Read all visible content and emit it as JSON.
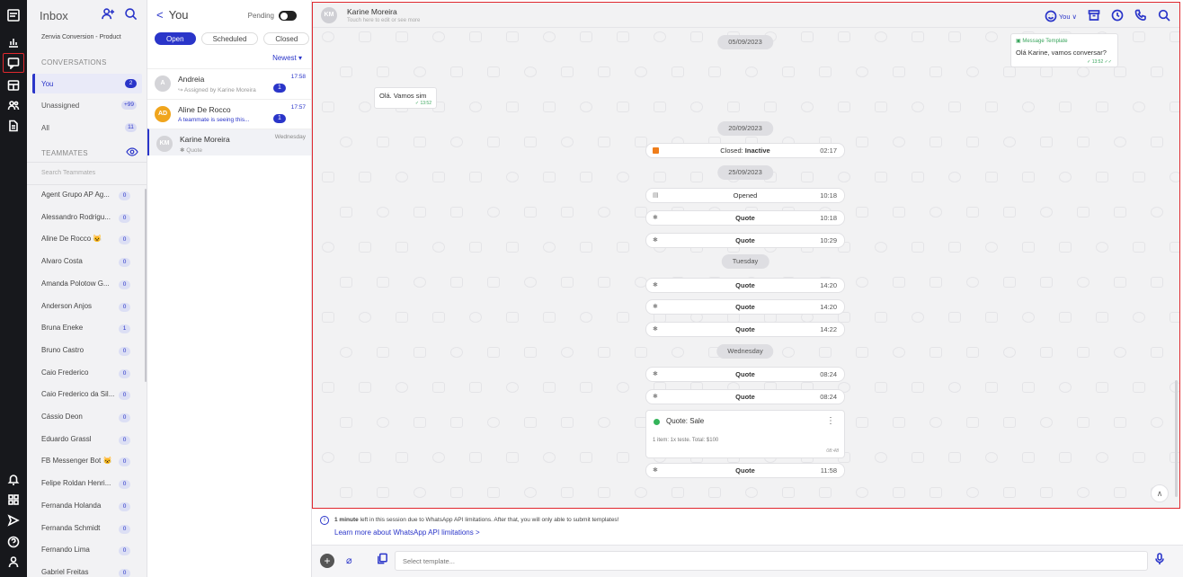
{
  "rail": {
    "top_icons": [
      "logo-icon",
      "reports-icon",
      "conversations-icon",
      "dashboard-icon",
      "contacts-icon",
      "documents-icon"
    ],
    "bottom_icons": [
      "bell-icon",
      "apps-icon",
      "send-icon",
      "help-icon",
      "profile-icon"
    ]
  },
  "inbox": {
    "title": "Inbox",
    "workspace": "Zenvia Conversion - Product",
    "conversations_label": "CONVERSATIONS",
    "items": [
      {
        "label": "You",
        "count": "2"
      },
      {
        "label": "Unassigned",
        "count": "+99"
      },
      {
        "label": "All",
        "count": "11"
      }
    ],
    "teammates_label": "TEAMMATES",
    "search_placeholder": "Search Teammates",
    "teammates": [
      {
        "name": "Agent Grupo AP Ag...",
        "count": "0"
      },
      {
        "name": "Alessandro Rodrigu...",
        "count": "0"
      },
      {
        "name": "Aline De Rocco 😺",
        "count": "0"
      },
      {
        "name": "Alvaro Costa",
        "count": "0"
      },
      {
        "name": "Amanda Polotow G...",
        "count": "0"
      },
      {
        "name": "Anderson Anjos",
        "count": "0"
      },
      {
        "name": "Bruna Eneke",
        "count": "1"
      },
      {
        "name": "Bruno Castro",
        "count": "0"
      },
      {
        "name": "Caio Frederico",
        "count": "0"
      },
      {
        "name": "Caio Frederico da Sil...",
        "count": "0"
      },
      {
        "name": "Cássio Deon",
        "count": "0"
      },
      {
        "name": "Eduardo Grassl",
        "count": "0"
      },
      {
        "name": "FB Messenger Bot 😺",
        "count": "0"
      },
      {
        "name": "Felipe Roldan Henri...",
        "count": "0"
      },
      {
        "name": "Fernanda Holanda",
        "count": "0"
      },
      {
        "name": "Fernanda Schmidt",
        "count": "0"
      },
      {
        "name": "Fernando Lima",
        "count": "0"
      },
      {
        "name": "Gabriel Freitas",
        "count": "0"
      }
    ]
  },
  "conv_list": {
    "title": "You",
    "pending_label": "Pending",
    "tabs": [
      "Open",
      "Scheduled",
      "Closed"
    ],
    "sort_label": "Newest ▾",
    "conversations": [
      {
        "initials": "A",
        "name": "Andreia",
        "subtitle": "↪ Assigned by Karine Moreira",
        "time": "17:58",
        "unread": "1"
      },
      {
        "initials": "AD",
        "name": "Aline De Rocco",
        "subtitle": "A teammate is seeing this...",
        "time": "17:57",
        "unread": "1"
      },
      {
        "initials": "KM",
        "name": "Karine Moreira",
        "subtitle": "Quote",
        "time": "Wednesday",
        "unread": ""
      }
    ]
  },
  "chat": {
    "contact_initials": "KM",
    "contact_name": "Karine Moreira",
    "contact_sub": "Touch here to edit or see more",
    "assignee_label": "You",
    "dates": [
      "05/09/2023",
      "20/09/2023",
      "25/09/2023",
      "Tuesday",
      "Wednesday"
    ],
    "incoming_text": "Olá. Vamos sim",
    "incoming_meta": "✓ 13:52",
    "template_header": "Message Template",
    "template_text": "Olá Karine, vamos conversar?",
    "template_meta": "✓ 13:52 ✓✓",
    "events": [
      {
        "icon": "orange",
        "label_prefix": "Closed: ",
        "label": "Inactive",
        "time": "02:17"
      },
      {
        "icon": "opened",
        "label_prefix": "",
        "label": "Opened",
        "time": "10:18"
      },
      {
        "icon": "quote",
        "label_prefix": "",
        "label": "Quote",
        "time": "10:18"
      },
      {
        "icon": "quote",
        "label_prefix": "",
        "label": "Quote",
        "time": "10:29"
      },
      {
        "icon": "quote",
        "label_prefix": "",
        "label": "Quote",
        "time": "14:20"
      },
      {
        "icon": "quote",
        "label_prefix": "",
        "label": "Quote",
        "time": "14:20"
      },
      {
        "icon": "quote",
        "label_prefix": "",
        "label": "Quote",
        "time": "14:22"
      },
      {
        "icon": "quote",
        "label_prefix": "",
        "label": "Quote",
        "time": "08:24"
      },
      {
        "icon": "quote",
        "label_prefix": "",
        "label": "Quote",
        "time": "08:24"
      },
      {
        "icon": "quote",
        "label_prefix": "",
        "label": "Quote",
        "time": "11:58"
      }
    ],
    "quote_card": {
      "title": "Quote: Sale",
      "body": "1 item: 1x teste. Total: $100",
      "time": "08:48"
    }
  },
  "info": {
    "bold": "1 minute",
    "text": " left in this session due to WhatsApp API limitations. After that, you will only able to submit templates!",
    "link": "Learn more about WhatsApp API limitations  >"
  },
  "composer": {
    "placeholder": "Select template..."
  }
}
